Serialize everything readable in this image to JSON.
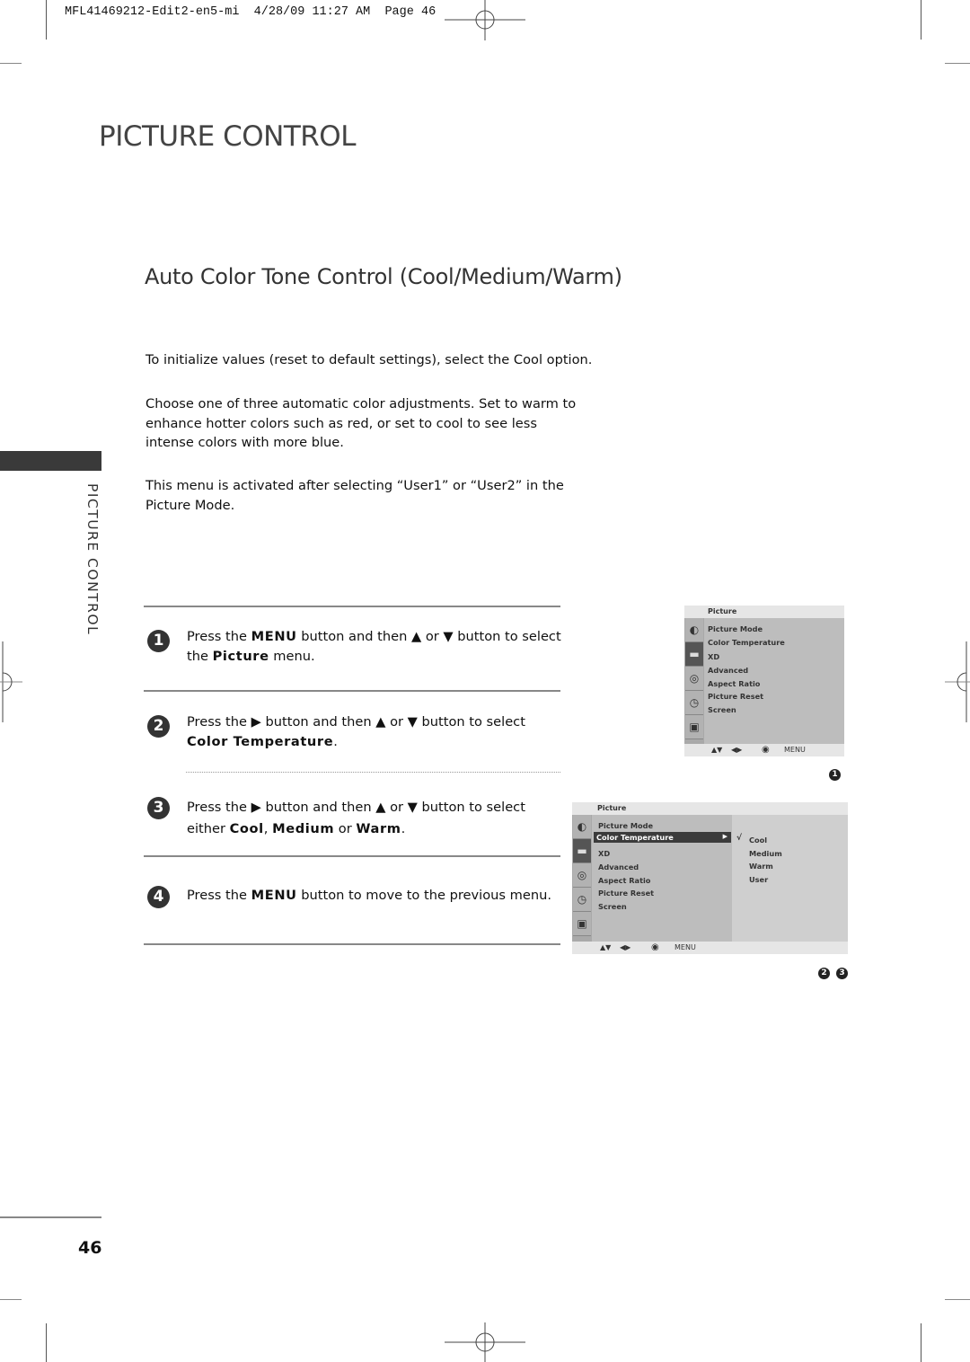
{
  "slug": {
    "text": "MFL41469212-Edit2-en5-mi  4/28/09 11:27 AM  Page 46"
  },
  "page": {
    "title": "PICTURE CONTROL",
    "subtitle": "Auto Color Tone Control (Cool/Medium/Warm)",
    "side_label": "PICTURE CONTROL",
    "page_number": "46"
  },
  "intro": [
    "To initialize values (reset to default settings), select the Cool option.",
    "Choose one of three automatic color adjustments. Set to warm to enhance hotter colors such as red, or set to cool to see less intense colors with more blue.",
    "This menu is activated after selecting “User1” or “User2” in the Picture Mode."
  ],
  "steps": [
    {
      "num": "1",
      "parts": [
        "Press the ",
        "MENU",
        " button and then ▲ or ▼ button to select the ",
        "Picture",
        " menu."
      ]
    },
    {
      "num": "2",
      "parts": [
        "Press the ▶ button and then ▲ or ▼ button to select ",
        "Color Temperature",
        "."
      ]
    },
    {
      "num": "3",
      "parts": [
        "Press the ▶ button and then ▲ or ▼ button to select either ",
        "Cool",
        ", ",
        "Medium",
        " or ",
        "Warm",
        "."
      ]
    },
    {
      "num": "4",
      "parts": [
        "Press the ",
        "MENU",
        " button to move to the previous menu."
      ]
    }
  ],
  "osd1": {
    "header": "Picture",
    "items": [
      "Picture Mode",
      "Color Temperature",
      "XD",
      "Advanced",
      "Aspect Ratio",
      "Picture Reset",
      "Screen"
    ],
    "footer": {
      "nav_updown": "▲▼",
      "nav_leftright": "◀▶",
      "ok": "◉",
      "menu": "MENU"
    },
    "marker": "1"
  },
  "osd2": {
    "header": "Picture",
    "items": [
      "Picture Mode",
      "Color Temperature",
      "XD",
      "Advanced",
      "Aspect Ratio",
      "Picture Reset",
      "Screen"
    ],
    "selected_index": 1,
    "selected_arrow": "▶",
    "options": [
      "Cool",
      "Medium",
      "Warm",
      "User"
    ],
    "checked_option": "Cool",
    "check_mark": "√",
    "footer": {
      "nav_updown": "▲▼",
      "nav_leftright": "◀▶",
      "ok": "◉",
      "menu": "MENU"
    },
    "markers": [
      "2",
      "3"
    ]
  },
  "icons": [
    "picture-icon",
    "screen-icon",
    "audio-icon",
    "time-icon",
    "lock-icon"
  ]
}
